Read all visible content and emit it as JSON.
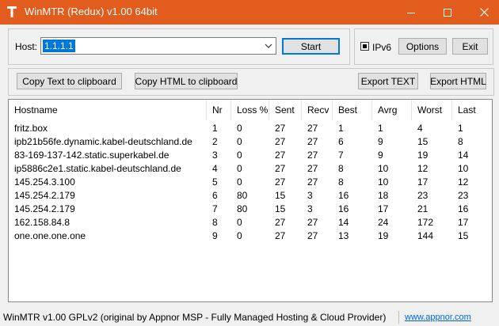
{
  "window": {
    "title": "WinMTR (Redux) v1.00 64bit",
    "accent": "#e25c1d"
  },
  "host": {
    "label": "Host:",
    "value": "1.1.1.1",
    "start_label": "Start",
    "ipv6_label": "IPv6",
    "ipv6_checked": true,
    "options_label": "Options",
    "exit_label": "Exit"
  },
  "toolbar": {
    "copy_text_label": "Copy Text to clipboard",
    "copy_html_label": "Copy HTML to clipboard",
    "export_text_label": "Export TEXT",
    "export_html_label": "Export HTML"
  },
  "table": {
    "columns": [
      "Hostname",
      "Nr",
      "Loss %",
      "Sent",
      "Recv",
      "Best",
      "Avrg",
      "Worst",
      "Last"
    ],
    "rows": [
      [
        "fritz.box",
        "1",
        "0",
        "27",
        "27",
        "1",
        "1",
        "4",
        "1"
      ],
      [
        "ipb21b56fe.dynamic.kabel-deutschland.de",
        "2",
        "0",
        "27",
        "27",
        "6",
        "9",
        "15",
        "8"
      ],
      [
        "83-169-137-142.static.superkabel.de",
        "3",
        "0",
        "27",
        "27",
        "7",
        "9",
        "19",
        "14"
      ],
      [
        "ip5886c2e1.static.kabel-deutschland.de",
        "4",
        "0",
        "27",
        "27",
        "8",
        "10",
        "12",
        "10"
      ],
      [
        "145.254.3.100",
        "5",
        "0",
        "27",
        "27",
        "8",
        "10",
        "17",
        "12"
      ],
      [
        "145.254.2.179",
        "6",
        "80",
        "15",
        "3",
        "16",
        "18",
        "23",
        "23"
      ],
      [
        "145.254.2.179",
        "7",
        "80",
        "15",
        "3",
        "16",
        "17",
        "21",
        "16"
      ],
      [
        "162.158.84.8",
        "8",
        "0",
        "27",
        "27",
        "14",
        "24",
        "172",
        "17"
      ],
      [
        "one.one.one.one",
        "9",
        "0",
        "27",
        "27",
        "13",
        "19",
        "144",
        "15"
      ]
    ]
  },
  "statusbar": {
    "text": "WinMTR v1.00 GPLv2 (original by Appnor MSP - Fully Managed Hosting & Cloud Provider)",
    "link": "www.appnor.com"
  },
  "icons": {
    "app": "winmtr-app-icon",
    "minimize": "minimize-icon",
    "maximize": "maximize-icon",
    "close": "close-icon",
    "dropdown": "chevron-down-icon"
  }
}
